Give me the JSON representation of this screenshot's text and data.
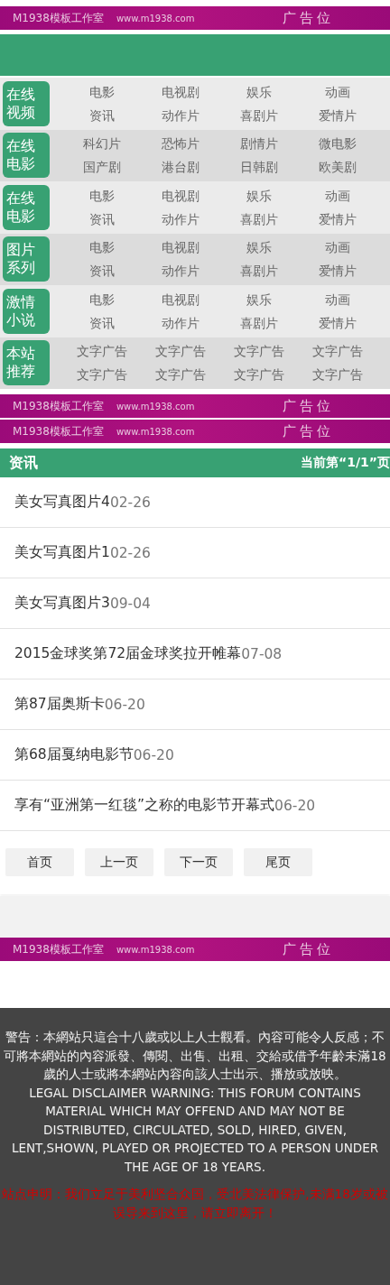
{
  "top_banner": {
    "brand": "M1938模板工作室",
    "url": "www.m1938.com",
    "ad": "广告位"
  },
  "nav_sections": [
    {
      "label": "在线视频",
      "links": [
        "电影",
        "电视剧",
        "娱乐",
        "动画",
        "资讯",
        "动作片",
        "喜剧片",
        "爱情片"
      ]
    },
    {
      "label": "在线电影",
      "links": [
        "科幻片",
        "恐怖片",
        "剧情片",
        "微电影",
        "国产剧",
        "港台剧",
        "日韩剧",
        "欧美剧"
      ]
    },
    {
      "label": "在线电影",
      "links": [
        "电影",
        "电视剧",
        "娱乐",
        "动画",
        "资讯",
        "动作片",
        "喜剧片",
        "爱情片"
      ]
    },
    {
      "label": "图片系列",
      "links": [
        "电影",
        "电视剧",
        "娱乐",
        "动画",
        "资讯",
        "动作片",
        "喜剧片",
        "爱情片"
      ]
    },
    {
      "label": "激情小说",
      "links": [
        "电影",
        "电视剧",
        "娱乐",
        "动画",
        "资讯",
        "动作片",
        "喜剧片",
        "爱情片"
      ]
    },
    {
      "label": "本站推荐",
      "links": [
        "文字广告",
        "文字广告",
        "文字广告",
        "文字广告",
        "文字广告",
        "文字广告",
        "文字广告",
        "文字广告"
      ]
    }
  ],
  "middle_banners": [
    {
      "brand": "M1938模板工作室",
      "url": "www.m1938.com",
      "ad": "广告位"
    },
    {
      "brand": "M1938模板工作室",
      "url": "www.m1938.com",
      "ad": "广告位"
    }
  ],
  "list": {
    "title": "资讯",
    "page_info": "当前第“1/1”页",
    "items": [
      {
        "title": "美女写真图片4",
        "date": "02-26"
      },
      {
        "title": "美女写真图片1",
        "date": "02-26"
      },
      {
        "title": "美女写真图片3",
        "date": "09-04"
      },
      {
        "title": "2015金球奖第72届金球奖拉开帷幕",
        "date": "07-08"
      },
      {
        "title": "第87届奥斯卡",
        "date": "06-20"
      },
      {
        "title": "第68届戛纳电影节",
        "date": "06-20"
      },
      {
        "title": "享有“亚洲第一红毯”之称的电影节开幕式",
        "date": "06-20"
      }
    ],
    "pager": [
      "首页",
      "上一页",
      "下一页",
      "尾页"
    ]
  },
  "bottom_banner": {
    "brand": "M1938模板工作室",
    "url": "www.m1938.com",
    "ad": "广告位"
  },
  "footer": {
    "warning": "警告：本網站只這合十八歲或以上人士觀看。內容可能令人反感；不可將本網站的內容派發、傳閱、出售、出租、交給或借予年齡未滿18歲的人士或將本網站內容向該人士出示、播放或放映。",
    "disclaimer": "LEGAL DISCLAIMER WARNING: THIS FORUM CONTAINS MATERIAL WHICH MAY OFFEND AND MAY NOT BE DISTRIBUTED, CIRCULATED, SOLD, HIRED, GIVEN, LENT,SHOWN, PLAYED OR PROJECTED TO A PERSON UNDER THE AGE OF 18 YEARS.",
    "notice": "站点申明：我们立足于美利坚合众国，受北美法律保护,未满18岁或被误导来到这里，请立即离开！"
  }
}
